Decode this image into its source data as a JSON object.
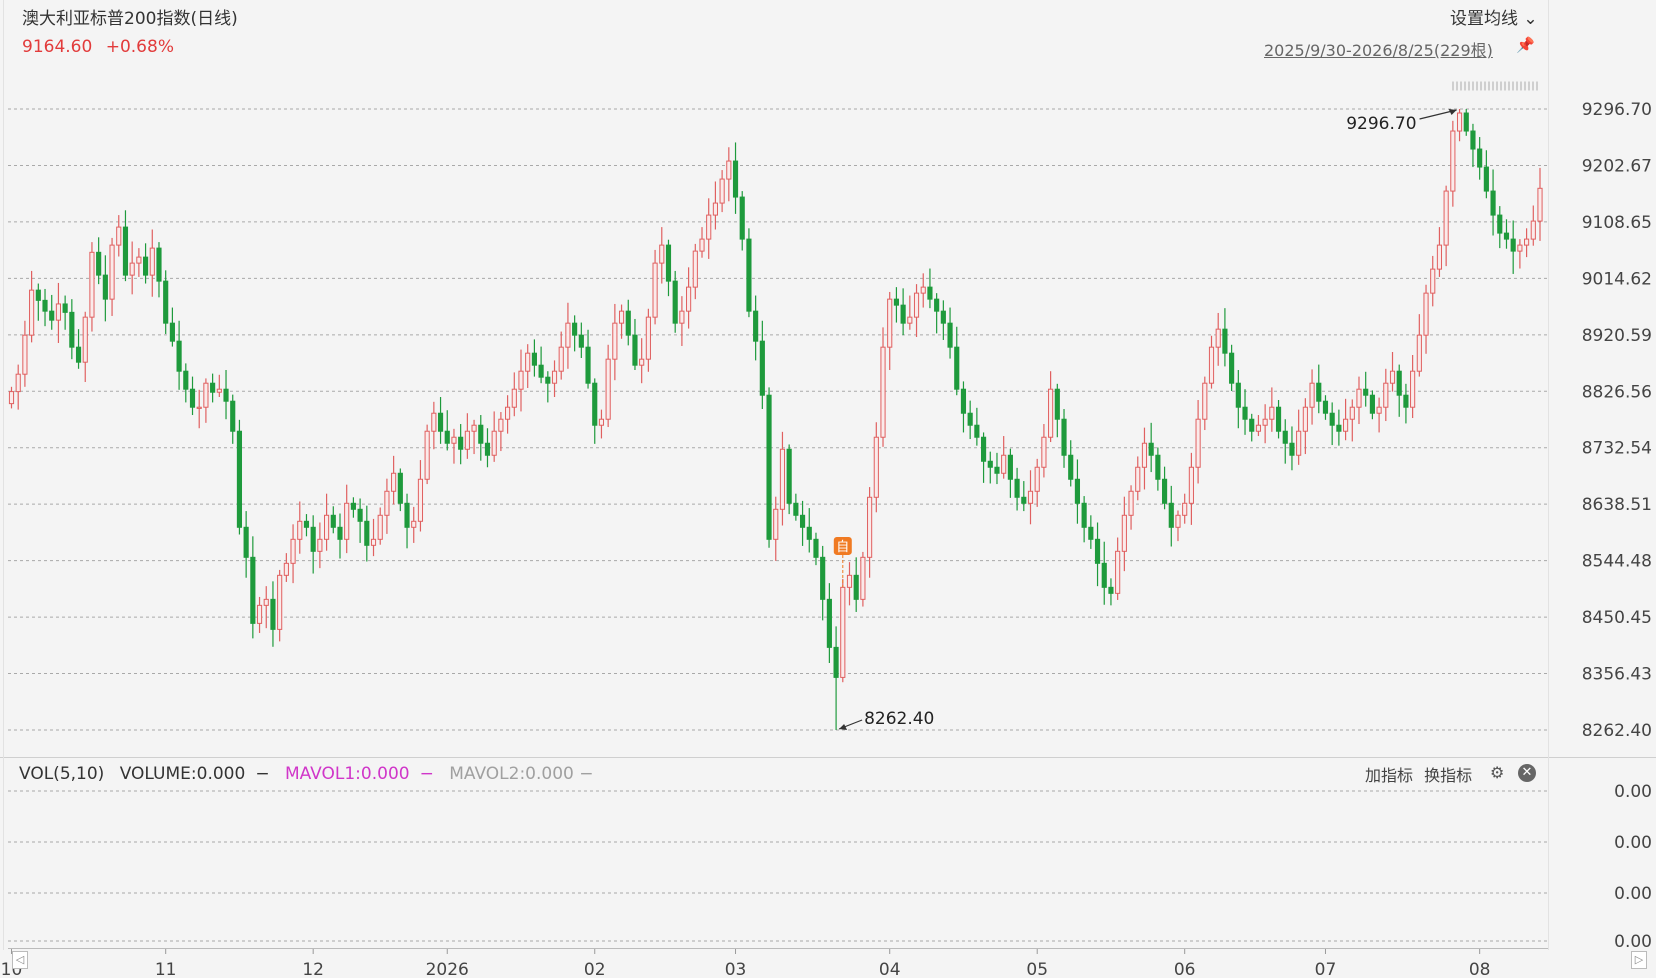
{
  "header": {
    "title": "澳大利亚标普200指数(日线)",
    "last_price": "9164.60",
    "change_pct": "+0.68%",
    "ma_setting_label": "设置均线",
    "date_range": "2025/9/30-2026/8/25(229根)"
  },
  "volume_panel": {
    "name": "VOL(5,10)",
    "volume": "VOLUME:0.000",
    "mavol1": "MAVOL1:0.000",
    "mavol2": "MAVOL2:0.000",
    "add_indicator": "加指标",
    "switch_indicator": "换指标",
    "y_ticks": [
      "0.00",
      "0.00",
      "0.00",
      "0.00"
    ]
  },
  "colors": {
    "up": "#e06060",
    "down": "#1e9a3c",
    "price_text": "#e23b3b",
    "mavol1": "#d036c9",
    "mavol2": "#a0a0a0"
  },
  "icons": [
    "chevron-down-icon",
    "pin-icon",
    "gear-icon",
    "close-icon",
    "arrow-left-icon",
    "arrow-right-icon"
  ],
  "chart_data": {
    "type": "candlestick",
    "y_ticks": [
      "9296.70",
      "9202.67",
      "9108.65",
      "9014.62",
      "8920.59",
      "8826.56",
      "8732.54",
      "8638.51",
      "8544.48",
      "8450.45",
      "8356.43",
      "8262.40"
    ],
    "ylim": [
      8262.4,
      9296.7
    ],
    "x_tick_labels": [
      "10",
      "11",
      "12",
      "2026",
      "02",
      "03",
      "04",
      "05",
      "06",
      "07",
      "08"
    ],
    "x_tick_index": [
      0,
      23,
      45,
      65,
      87,
      108,
      131,
      153,
      175,
      196,
      219
    ],
    "max_annotation": "9296.70",
    "min_annotation": "8262.40",
    "marker_label": "自",
    "marker_index": 124,
    "closes": [
      8826,
      8855,
      8920,
      8995,
      8978,
      8960,
      8945,
      8972,
      8958,
      8900,
      8875,
      8950,
      9058,
      9020,
      8980,
      9070,
      9100,
      9020,
      9040,
      9050,
      9020,
      9065,
      9010,
      8940,
      8910,
      8860,
      8830,
      8800,
      8800,
      8840,
      8825,
      8830,
      8810,
      8760,
      8600,
      8550,
      8440,
      8470,
      8480,
      8430,
      8520,
      8540,
      8580,
      8610,
      8600,
      8560,
      8580,
      8620,
      8600,
      8580,
      8640,
      8630,
      8610,
      8570,
      8580,
      8620,
      8660,
      8690,
      8640,
      8600,
      8610,
      8680,
      8760,
      8790,
      8760,
      8740,
      8750,
      8730,
      8760,
      8770,
      8740,
      8720,
      8760,
      8780,
      8800,
      8830,
      8860,
      8890,
      8870,
      8850,
      8840,
      8860,
      8900,
      8940,
      8920,
      8900,
      8840,
      8770,
      8780,
      8880,
      8940,
      8960,
      8920,
      8870,
      8880,
      8950,
      9040,
      9070,
      9010,
      8940,
      8960,
      9000,
      9060,
      9080,
      9120,
      9140,
      9180,
      9210,
      9150,
      9080,
      8960,
      8910,
      8820,
      8580,
      8630,
      8730,
      8640,
      8620,
      8600,
      8580,
      8550,
      8480,
      8400,
      8350,
      8500,
      8520,
      8480,
      8550,
      8650,
      8750,
      8900,
      8980,
      8970,
      8940,
      8950,
      8990,
      9000,
      8980,
      8960,
      8940,
      8900,
      8830,
      8790,
      8770,
      8750,
      8710,
      8700,
      8690,
      8720,
      8680,
      8650,
      8640,
      8660,
      8700,
      8750,
      8830,
      8780,
      8720,
      8680,
      8640,
      8600,
      8580,
      8540,
      8500,
      8490,
      8560,
      8620,
      8660,
      8700,
      8740,
      8720,
      8680,
      8640,
      8600,
      8620,
      8640,
      8700,
      8780,
      8840,
      8900,
      8930,
      8890,
      8840,
      8800,
      8780,
      8760,
      8770,
      8780,
      8800,
      8760,
      8740,
      8720,
      8760,
      8800,
      8840,
      8810,
      8790,
      8770,
      8760,
      8780,
      8800,
      8830,
      8820,
      8790,
      8800,
      8840,
      8860,
      8820,
      8800,
      8860,
      8920,
      8990,
      9030,
      9070,
      9160,
      9260,
      9290,
      9260,
      9230,
      9200,
      9160,
      9120,
      9090,
      9080,
      9060,
      9070,
      9080,
      9110,
      9164.6
    ]
  }
}
